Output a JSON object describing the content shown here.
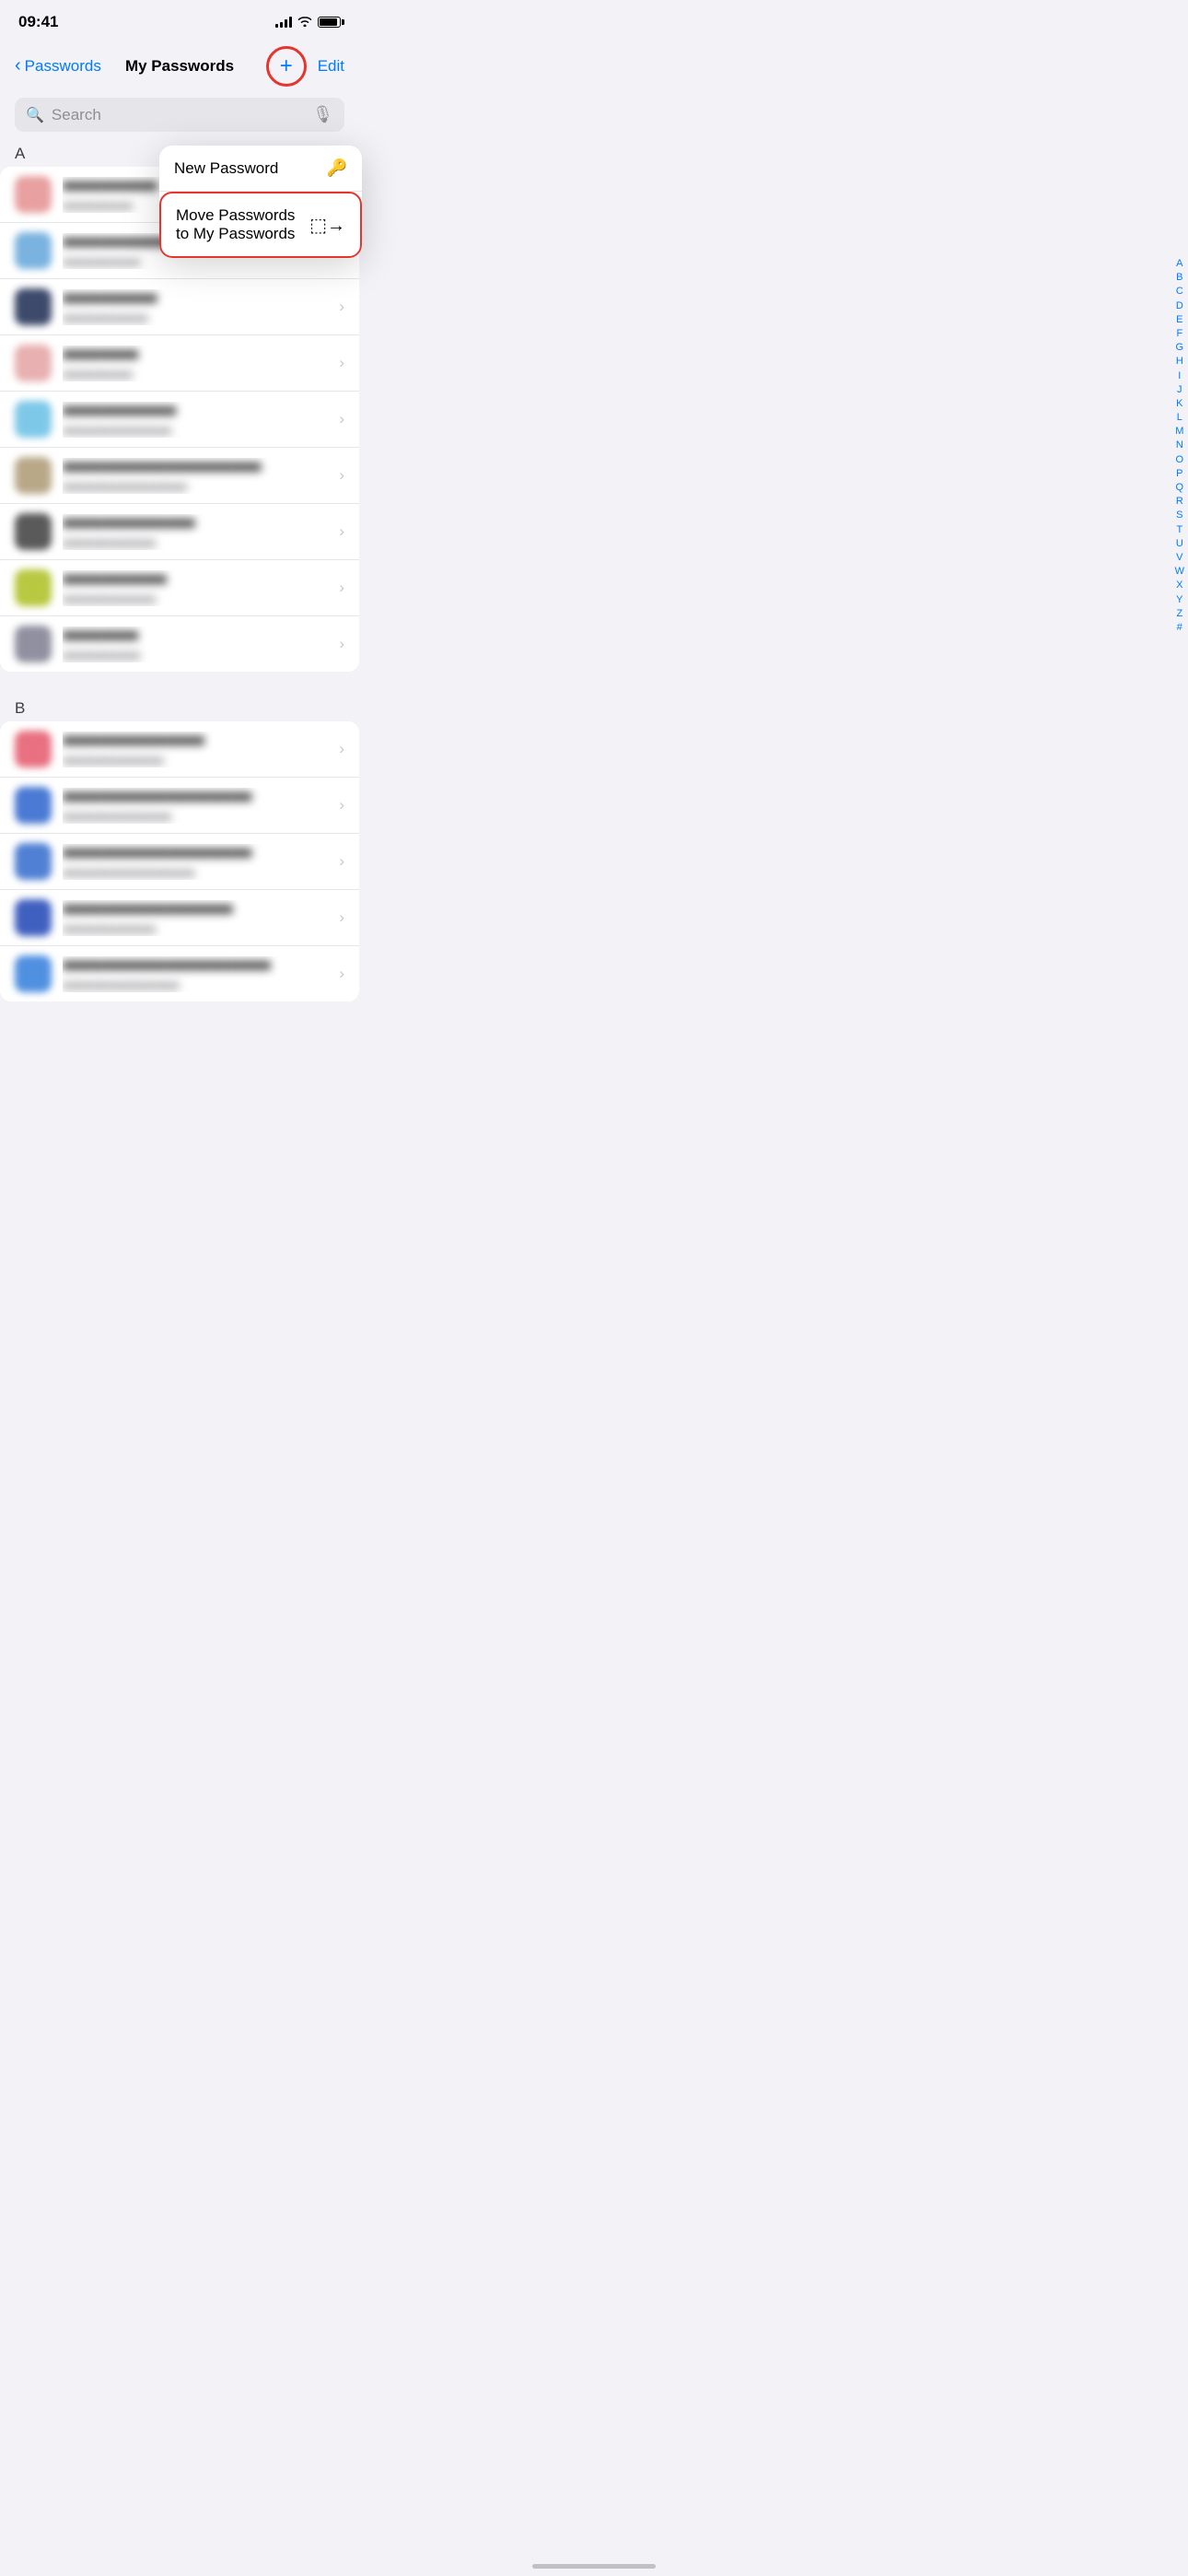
{
  "statusBar": {
    "time": "09:41",
    "signalBars": [
      4,
      6,
      8,
      10,
      12
    ],
    "battery": 90
  },
  "nav": {
    "backLabel": "Passwords",
    "title": "My Passwords",
    "addLabel": "+",
    "editLabel": "Edit"
  },
  "search": {
    "placeholder": "Search"
  },
  "dropdown": {
    "items": [
      {
        "label": "New Password",
        "icon": "🔑"
      },
      {
        "label": "Move Passwords to My Passwords",
        "icon": "→"
      }
    ]
  },
  "alphabetIndex": [
    "A",
    "B",
    "C",
    "D",
    "E",
    "F",
    "G",
    "H",
    "I",
    "J",
    "K",
    "L",
    "M",
    "N",
    "O",
    "P",
    "Q",
    "R",
    "S",
    "T",
    "U",
    "V",
    "W",
    "X",
    "Y",
    "Z",
    "#"
  ],
  "sections": [
    {
      "letter": "A",
      "items": [
        {
          "iconBg": "#e8a0a0",
          "titleBlur": "■■■■■■■■■■",
          "subtitleBlur": "■■■■■■■■■"
        },
        {
          "iconBg": "#7ab3e0",
          "titleBlur": "■■■■■■■■■■■■",
          "subtitleBlur": "■■■■■■■■■■"
        },
        {
          "iconBg": "#3d4a6b",
          "titleBlur": "■■■■■■■■■■",
          "subtitleBlur": "■■■■■■■■■■■"
        },
        {
          "iconBg": "#e8b0b0",
          "titleBlur": "■■■■■■■■",
          "subtitleBlur": "■■■■■■■■■"
        },
        {
          "iconBg": "#7dc8e8",
          "titleBlur": "■■■■■■■■■■■■",
          "subtitleBlur": "■■■■■■■■■■■■■■"
        },
        {
          "iconBg": "#6b6b6b",
          "titleBlur": "■■■■■■■■■■■■■■■■■■■■■",
          "subtitleBlur": "■■■■■■■■■■■■■■■■"
        },
        {
          "iconBg": "#5a5a5a",
          "titleBlur": "■■■■■■■■■■■■■■",
          "subtitleBlur": "■■■■■■■■■■■■"
        },
        {
          "iconBg": "#b8c840",
          "titleBlur": "■■■■■■■■■■■",
          "subtitleBlur": "■■■■■■■■■■■■"
        },
        {
          "iconBg": "#9090a0",
          "titleBlur": "■■■■■■■■",
          "subtitleBlur": "■■■■■■■■■■"
        }
      ]
    },
    {
      "letter": "B",
      "items": [
        {
          "iconBg": "#e87080",
          "titleBlur": "■■■■■■■■■■■■■■■",
          "subtitleBlur": "■■■■■■■■■■■■■"
        },
        {
          "iconBg": "#4a7ad4",
          "titleBlur": "■■■■■■■■■■■■■■■■■■■■",
          "subtitleBlur": "■■■■■■■■■■■■■■"
        },
        {
          "iconBg": "#5080d4",
          "titleBlur": "■■■■■■■■■■■■■■■■■■■■",
          "subtitleBlur": "■■■■■■■■■■■■■■■■■"
        },
        {
          "iconBg": "#4060c0",
          "titleBlur": "■■■■■■■■■■■■■■■■■■",
          "subtitleBlur": "■■■■■■■■■■■■"
        },
        {
          "iconBg": "#5090e0",
          "titleBlur": "■■■■■■■■■■■■■■■■■■■■■■",
          "subtitleBlur": "■■■■■■■■■■■■■■■"
        }
      ]
    }
  ]
}
